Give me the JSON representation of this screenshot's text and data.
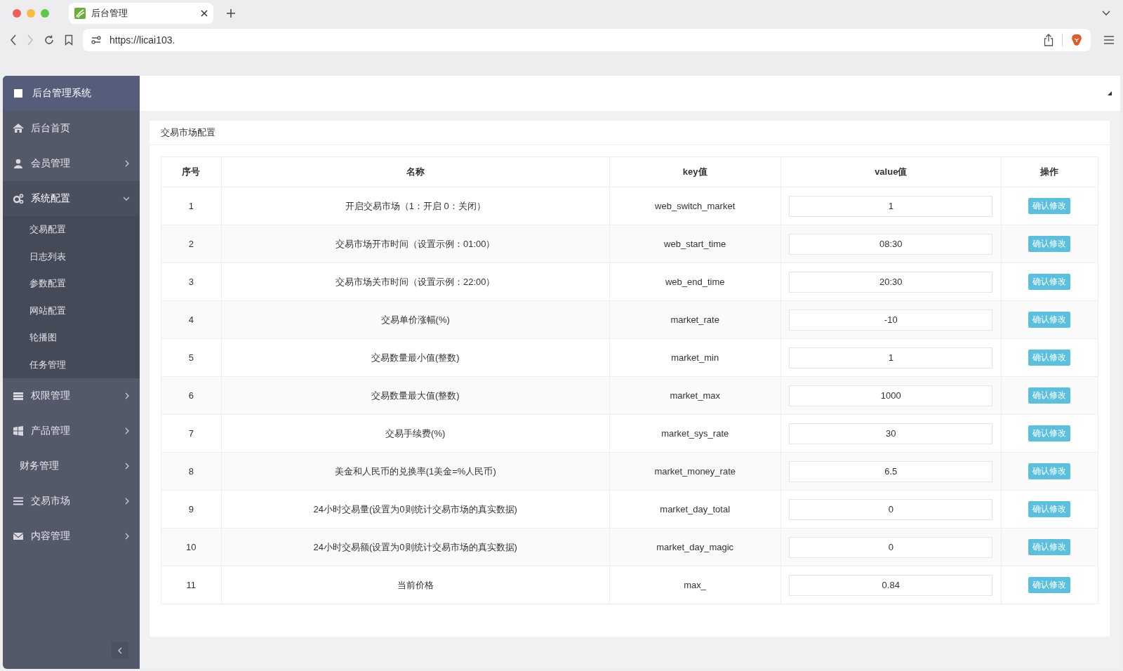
{
  "browser": {
    "tab_title": "后台管理",
    "url": "https://licai103."
  },
  "sidebar": {
    "title": "后台管理系统",
    "items": [
      {
        "label": "后台首页",
        "has_arrow": false,
        "expanded": false
      },
      {
        "label": "会员管理",
        "has_arrow": true,
        "expanded": false
      },
      {
        "label": "系统配置",
        "has_arrow": true,
        "expanded": true,
        "children": [
          {
            "label": "交易配置"
          },
          {
            "label": "日志列表"
          },
          {
            "label": "参数配置"
          },
          {
            "label": "网站配置"
          },
          {
            "label": "轮播图"
          },
          {
            "label": "任务管理"
          }
        ]
      },
      {
        "label": "权限管理",
        "has_arrow": true,
        "expanded": false
      },
      {
        "label": "产品管理",
        "has_arrow": true,
        "expanded": false
      },
      {
        "label": "财务管理",
        "has_arrow": true,
        "expanded": false
      },
      {
        "label": "交易市场",
        "has_arrow": true,
        "expanded": false
      },
      {
        "label": "内容管理",
        "has_arrow": true,
        "expanded": false
      }
    ]
  },
  "panel": {
    "title": "交易市场配置"
  },
  "table": {
    "columns": [
      "序号",
      "名称",
      "key值",
      "value值",
      "操作"
    ],
    "rows": [
      {
        "index": "1",
        "name": "开启交易市场（1：开启 0：关闭）",
        "key": "web_switch_market",
        "value": "1",
        "action": "确认修改"
      },
      {
        "index": "2",
        "name": "交易市场开市时间（设置示例：01:00）",
        "key": "web_start_time",
        "value": "08:30",
        "action": "确认修改"
      },
      {
        "index": "3",
        "name": "交易市场关市时间（设置示例：22:00）",
        "key": "web_end_time",
        "value": "20:30",
        "action": "确认修改"
      },
      {
        "index": "4",
        "name": "交易单价涨幅(%)",
        "key": "market_rate",
        "value": "-10",
        "action": "确认修改"
      },
      {
        "index": "5",
        "name": "交易数量最小值(整数)",
        "key": "market_min",
        "value": "1",
        "action": "确认修改"
      },
      {
        "index": "6",
        "name": "交易数量最大值(整数)",
        "key": "market_max",
        "value": "1000",
        "action": "确认修改"
      },
      {
        "index": "7",
        "name": "交易手续费(%)",
        "key": "market_sys_rate",
        "value": "30",
        "action": "确认修改"
      },
      {
        "index": "8",
        "name": "美金和人民币的兑换率(1美金=%人民币)",
        "key": "market_money_rate",
        "value": "6.5",
        "action": "确认修改"
      },
      {
        "index": "9",
        "name": "24小时交易量(设置为0则统计交易市场的真实数据)",
        "key": "market_day_total",
        "value": "0",
        "action": "确认修改"
      },
      {
        "index": "10",
        "name": "24小时交易额(设置为0则统计交易市场的真实数据)",
        "key": "market_day_magic",
        "value": "0",
        "action": "确认修改"
      },
      {
        "index": "11",
        "name": "当前价格",
        "key": "max_",
        "value": "0.84",
        "action": "确认修改"
      }
    ]
  }
}
